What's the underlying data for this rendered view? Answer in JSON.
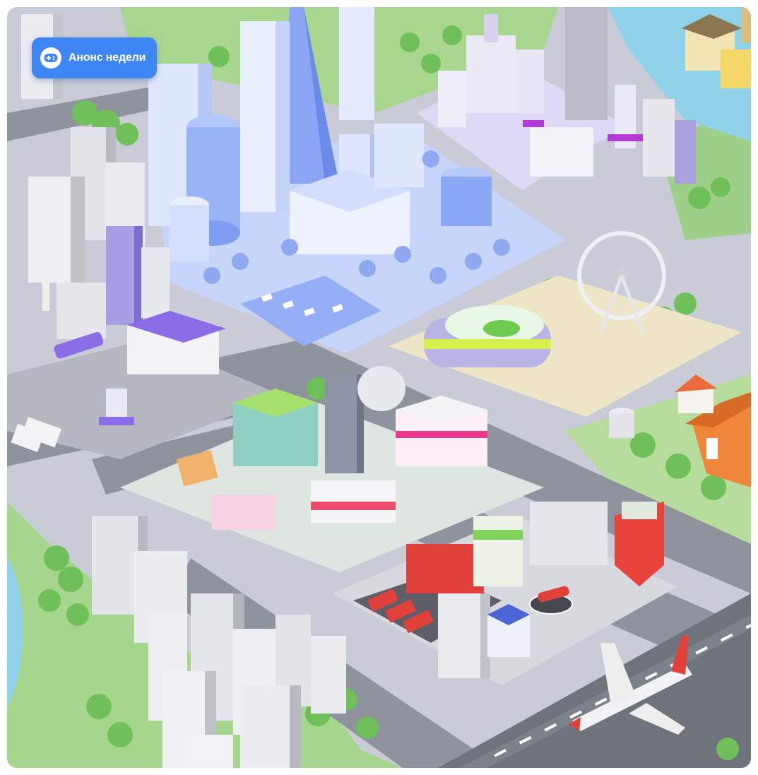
{
  "announce_button": {
    "label": "Анонс недели",
    "icon": "gamepad-icon",
    "color": "#3f86f5"
  },
  "palette": {
    "grass": "#9fd08a",
    "road": "#8f939d",
    "water": "#8fd2ea",
    "business_district": "#c8d5fb",
    "university_accent": "#b43ad6",
    "farm_accent": "#f0863a",
    "fire_station": "#e2413b"
  }
}
